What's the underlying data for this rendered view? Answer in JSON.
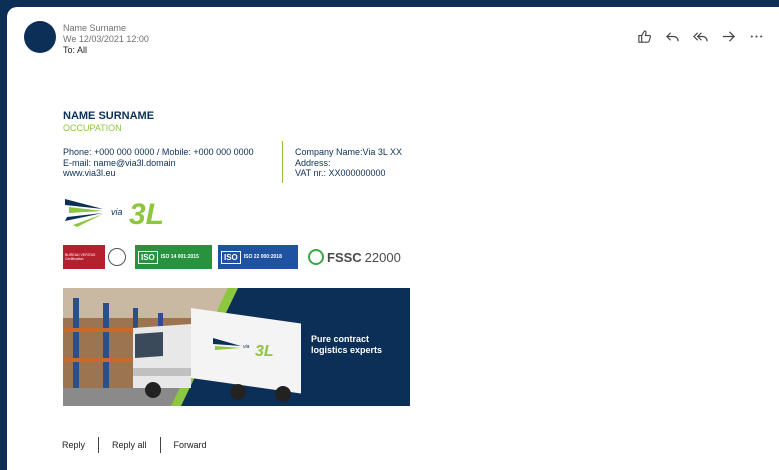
{
  "message": {
    "sender": "Name Surname",
    "date": "We 12/03/2021 12:00",
    "to": "To: All"
  },
  "actions": [
    {
      "name": "like-icon"
    },
    {
      "name": "reply-icon"
    },
    {
      "name": "reply-all-icon"
    },
    {
      "name": "forward-icon"
    },
    {
      "name": "more-icon"
    }
  ],
  "signature": {
    "name": "NAME SURNAME",
    "occupation": "OCCUPATION",
    "contacts": {
      "phone": "Phone: +000 000 0000 / Mobile: +000 000 0000",
      "email": "E-mail: name@via3l.domain",
      "web": "www.via3l.eu"
    },
    "company": {
      "name": "Company Name:Via 3L XX",
      "address": "Address:",
      "vat": "VAT nr.: XX000000000"
    },
    "logo_text": "via 3L",
    "certs": {
      "bv_text": "BUREAU VERITAS Certification",
      "iso1": "ISO 14 001:2015",
      "iso2": "ISO 22 000:2018",
      "fssc": "FSSC",
      "fssc_num": "22000"
    },
    "banner": {
      "logo_text": "via 3L",
      "tagline_1": "Pure contract",
      "tagline_2": "logistics experts"
    }
  },
  "footer": {
    "reply": "Reply",
    "reply_all": "Reply all",
    "forward": "Forward"
  },
  "colors": {
    "navy": "#0c2f57",
    "green": "#8dc63f"
  }
}
